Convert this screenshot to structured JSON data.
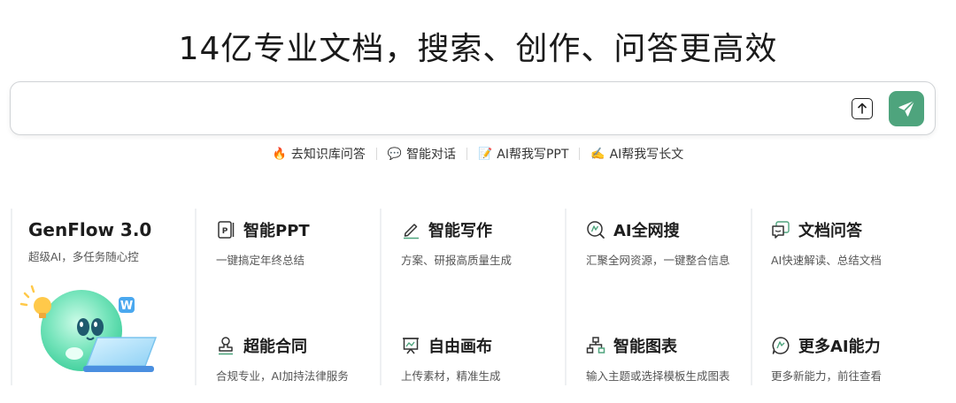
{
  "header": {
    "title": "14亿专业文档，搜索、创作、问答更高效"
  },
  "search": {
    "value": "",
    "placeholder": ""
  },
  "quick_links": [
    {
      "icon": "fire-icon",
      "label": "去知识库问答"
    },
    {
      "icon": "chat-bubble-icon",
      "label": "智能对话"
    },
    {
      "icon": "memo-icon",
      "label": "AI帮我写PPT"
    },
    {
      "icon": "writing-hand-icon",
      "label": "AI帮我写长文"
    }
  ],
  "features": {
    "genflow": {
      "title": "GenFlow 3.0",
      "desc": "超级AI，多任务随心控"
    },
    "items": [
      {
        "icon": "ppt-icon",
        "title": "智能PPT",
        "desc": "一键搞定年终总结"
      },
      {
        "icon": "pen-icon",
        "title": "智能写作",
        "desc": "方案、研报高质量生成"
      },
      {
        "icon": "web-search-icon",
        "title": "AI全网搜",
        "desc": "汇聚全网资源，一键整合信息"
      },
      {
        "icon": "doc-chat-icon",
        "title": "文档问答",
        "desc": "AI快速解读、总结文档"
      },
      {
        "icon": "contract-stamp-icon",
        "title": "超能合同",
        "desc": "合规专业，AI加持法律服务"
      },
      {
        "icon": "canvas-icon",
        "title": "自由画布",
        "desc": "上传素材，精准生成"
      },
      {
        "icon": "org-chart-icon",
        "title": "智能图表",
        "desc": "输入主题或选择模板生成图表"
      },
      {
        "icon": "more-ai-icon",
        "title": "更多AI能力",
        "desc": "更多新能力，前往查看"
      }
    ]
  },
  "colors": {
    "accent": "#4ea47d",
    "separator": "#eef0f2"
  }
}
